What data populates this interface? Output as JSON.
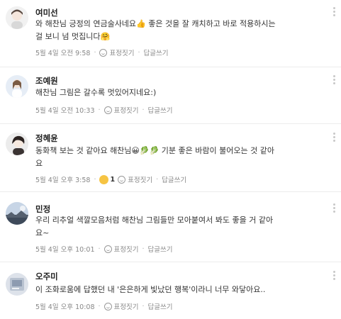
{
  "comments": [
    {
      "author": "여미선",
      "lines": [
        "와 해찬님 긍정의 연금술사네요👍 좋은 것을 잘 캐치하고 바로 적용하시는",
        "걸 보니 넘 멋집니다🤗"
      ],
      "time": "5월 4일 오전 9:58",
      "react_label": "표정짓기",
      "reply_label": "답글쓰기",
      "avatar_bg": "#f3f3f3"
    },
    {
      "author": "조예원",
      "lines": [
        "해찬님 그림은 갈수록 멋있어지네요:)"
      ],
      "time": "5월 4일 오전 10:33",
      "react_label": "표정짓기",
      "reply_label": "답글쓰기",
      "avatar_bg": "#e8eef7"
    },
    {
      "author": "정혜윤",
      "lines": [
        "동화책 보는 것 같아요 해찬님😀🥬🥬 기분 좋은 바람이 불어오는 것 같아",
        "요"
      ],
      "time": "5월 4일 오후 3:58",
      "reaction_count": "1",
      "react_label": "표정짓기",
      "reply_label": "답글쓰기",
      "avatar_bg": "#eaeaea"
    },
    {
      "author": "민정",
      "lines": [
        "우리 리추얼 색깔모음처럼 해찬님 그림들만 모아붙여서 봐도 좋을 거 같아",
        "요~"
      ],
      "time": "5월 4일 오후 10:01",
      "react_label": "표정짓기",
      "reply_label": "답글쓰기",
      "avatar_bg": "#c9d6e6"
    },
    {
      "author": "오주미",
      "lines": [
        "이 조화로움에 답했던 내 '은은하게 빛났던 행복'이라니 너무 와닿아요.."
      ],
      "time": "5월 4일 오후 10:08",
      "react_label": "표정짓기",
      "reply_label": "답글쓰기",
      "avatar_bg": "#dfe3ea"
    }
  ],
  "colors": {
    "divider": "#ececec",
    "meta_text": "#888888",
    "name_text": "#222222"
  }
}
